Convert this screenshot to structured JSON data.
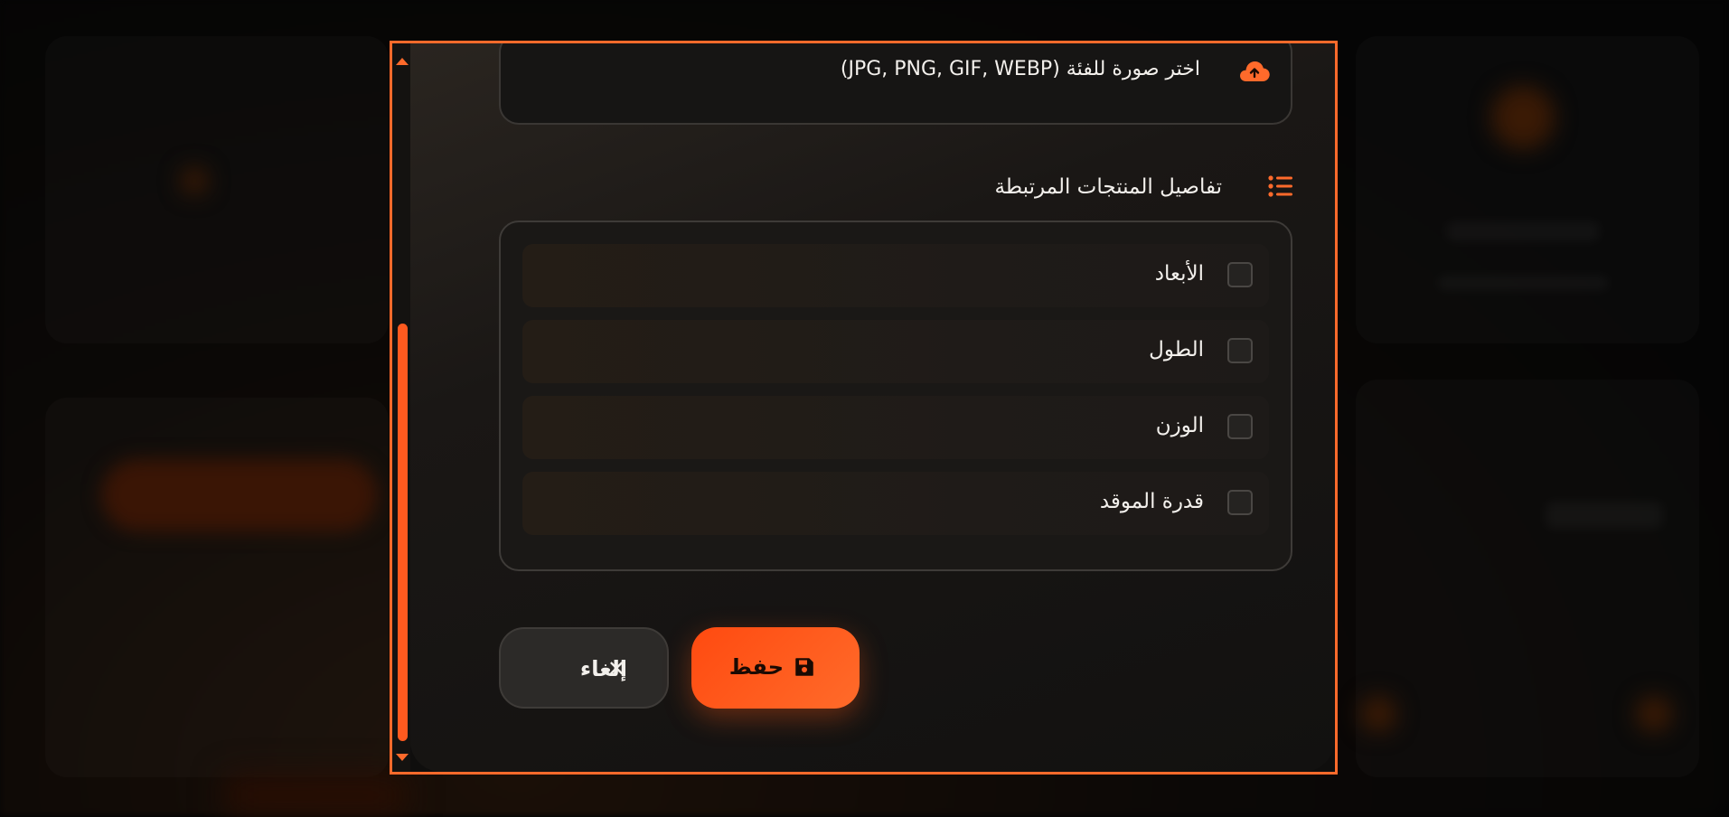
{
  "upload": {
    "label": "اختر صورة للفئة (JPG, PNG, GIF, WEBP)",
    "icon": "cloud-upload-icon"
  },
  "related_products": {
    "title": "تفاصيل المنتجات المرتبطة",
    "icon": "list-icon",
    "options": [
      {
        "label": "الأبعاد",
        "checked": false
      },
      {
        "label": "الطول",
        "checked": false
      },
      {
        "label": "الوزن",
        "checked": false
      },
      {
        "label": "قدرة الموقد",
        "checked": false
      }
    ]
  },
  "actions": {
    "save_label": "حفظ",
    "cancel_label": "إلغاء",
    "cancel_icon": "close-icon",
    "save_icon": "save-icon"
  },
  "colors": {
    "accent": "#ff5a1f",
    "panel": "#1a1816",
    "text": "#f3f0ec"
  }
}
